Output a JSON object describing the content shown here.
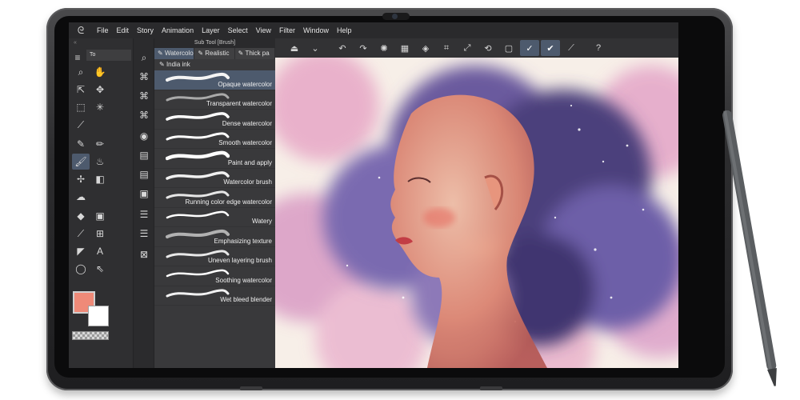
{
  "menu": [
    "File",
    "Edit",
    "Story",
    "Animation",
    "Layer",
    "Select",
    "View",
    "Filter",
    "Window",
    "Help"
  ],
  "tools_panel": {
    "tab_label": "To"
  },
  "subtool_panel": {
    "title": "Sub Tool [Brush]",
    "tabs": [
      "Watercolor",
      "Realistic",
      "Thick pa"
    ],
    "ink_label": "India ink",
    "brushes": [
      "Opaque watercolor",
      "Transparent watercolor",
      "Dense watercolor",
      "Smooth watercolor",
      "Paint and apply",
      "Watercolor brush",
      "Running color edge watercolor",
      "Watery",
      "Emphasizing texture",
      "Uneven layering brush",
      "Soothing watercolor",
      "Wet bleed blender"
    ]
  },
  "colors": {
    "main_color": "#ef8a78",
    "sub_color": "#ffffff",
    "accent": "#4d5a6d"
  },
  "canvas": {
    "subject": "watercolor girl portrait"
  }
}
